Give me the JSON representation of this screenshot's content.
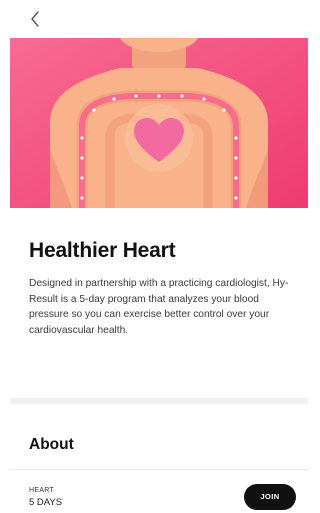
{
  "nav": {
    "back_icon": "chevron-left-icon"
  },
  "hero": {
    "icon": "heart-body-illustration",
    "colors": {
      "background": "#f3477a",
      "background_light": "#f86a92",
      "body": "#f9b28a",
      "body_shadow": "#f39a7c",
      "heart": "#f66fa3",
      "dots": "#ffffff"
    }
  },
  "program": {
    "title": "Healthier Heart",
    "description": "Designed in partnership with a practicing cardiologist, Hy-Result is a 5-day program that analyzes your blood pressure so you can exercise better control over your cardiovascular health.",
    "about_heading": "About",
    "category": "HEART",
    "duration": "5 DAYS",
    "join_label": "JOIN"
  },
  "colors": {
    "join_button": "#111111",
    "text_primary": "#121212",
    "divider": "#f1f1f1"
  }
}
